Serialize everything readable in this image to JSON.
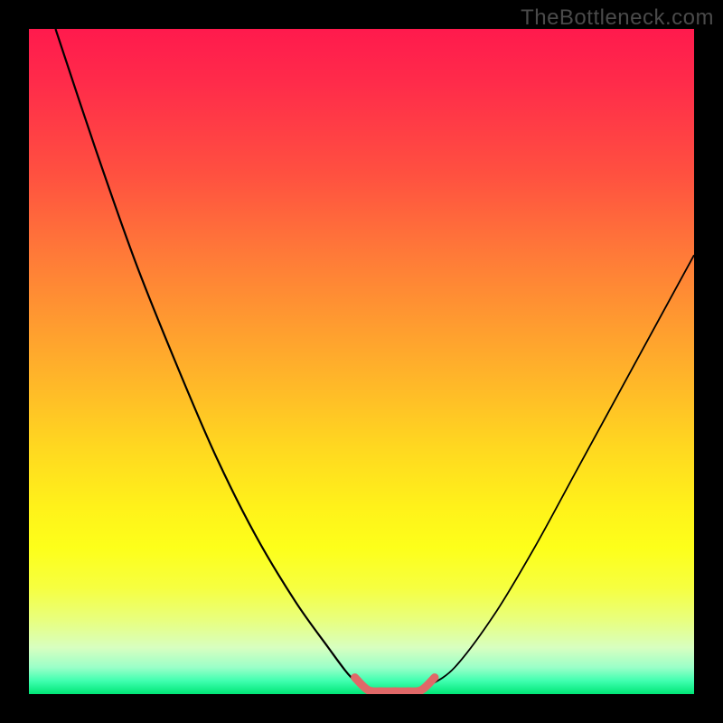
{
  "watermark": "TheBottleneck.com",
  "chart_data": {
    "type": "line",
    "title": "",
    "xlabel": "",
    "ylabel": "",
    "xlim": [
      0,
      100
    ],
    "ylim": [
      0,
      100
    ],
    "grid": false,
    "legend": false,
    "annotations": [],
    "background_gradient": {
      "orientation": "vertical",
      "stops": [
        {
          "pos": 0.0,
          "color": "#ff1a4d"
        },
        {
          "pos": 0.22,
          "color": "#ff5140"
        },
        {
          "pos": 0.44,
          "color": "#ff9a30"
        },
        {
          "pos": 0.63,
          "color": "#ffd820"
        },
        {
          "pos": 0.78,
          "color": "#fdff1a"
        },
        {
          "pos": 0.93,
          "color": "#d8ffc0"
        },
        {
          "pos": 1.0,
          "color": "#00e676"
        }
      ]
    },
    "series": [
      {
        "name": "left-curve",
        "stroke": "#000000",
        "stroke_width": 2.2,
        "x": [
          4.0,
          10.0,
          16.0,
          22.0,
          28.0,
          34.0,
          40.0,
          45.0,
          48.0,
          50.0
        ],
        "y": [
          100.0,
          82.0,
          65.0,
          50.0,
          36.0,
          24.0,
          14.0,
          7.0,
          3.0,
          1.2
        ]
      },
      {
        "name": "right-curve",
        "stroke": "#000000",
        "stroke_width": 1.8,
        "x": [
          60.0,
          64.0,
          70.0,
          76.0,
          82.0,
          88.0,
          94.0,
          100.0
        ],
        "y": [
          1.2,
          4.0,
          12.0,
          22.0,
          33.0,
          44.0,
          55.0,
          66.0
        ]
      },
      {
        "name": "bottom-highlight",
        "stroke": "#e06868",
        "stroke_width": 9,
        "linecap": "round",
        "x": [
          49.0,
          51.0,
          53.0,
          55.0,
          57.0,
          59.0,
          61.0
        ],
        "y": [
          2.5,
          0.6,
          0.4,
          0.4,
          0.4,
          0.6,
          2.5
        ]
      }
    ]
  }
}
